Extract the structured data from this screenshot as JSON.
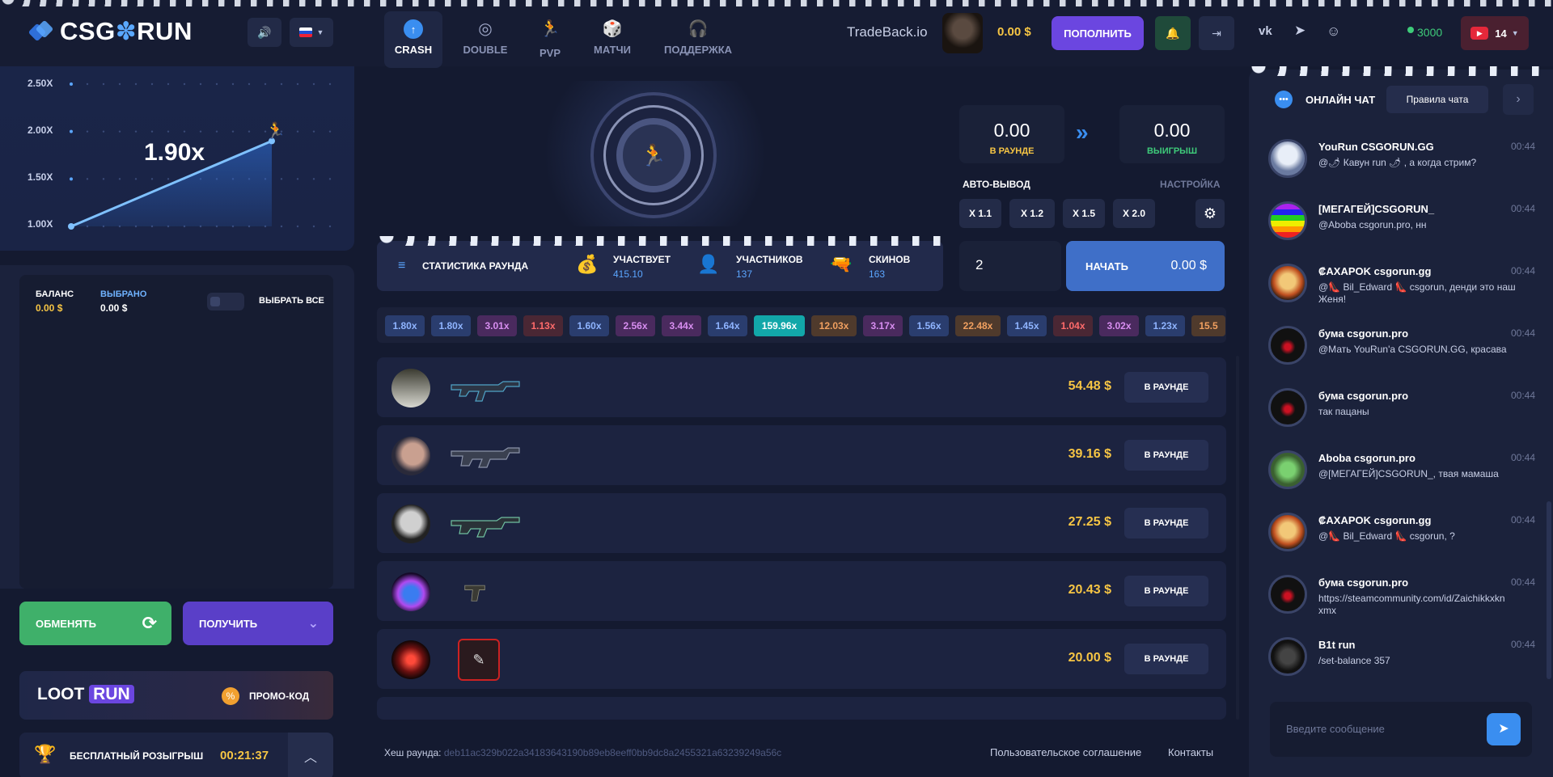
{
  "header": {
    "logo_text_a": "CSG",
    "logo_text_b": "RUN",
    "nav": [
      {
        "label": "CRASH",
        "icon": "crash-icon"
      },
      {
        "label": "DOUBLE",
        "icon": "double-icon"
      },
      {
        "label": "PVP",
        "icon": "pvp-icon"
      },
      {
        "label": "МАТЧИ",
        "icon": "dice-icon"
      },
      {
        "label": "ПОДДЕРЖКА",
        "icon": "headset-icon"
      }
    ],
    "tradeback": "TradeBack.io",
    "user_balance": "0.00 $",
    "deposit_label": "ПОПОЛНИТЬ",
    "online_count": "3000",
    "youtube_count": "14"
  },
  "chart": {
    "multiplier": "1.90x",
    "ylabels": [
      "2.50X",
      "2.00X",
      "1.50X",
      "1.00X"
    ]
  },
  "chart_data": {
    "type": "line",
    "title": "",
    "ylabel": "",
    "ylim": [
      1.0,
      2.5
    ],
    "yticks": [
      "1.00X",
      "1.50X",
      "2.00X",
      "2.50X"
    ],
    "series": [
      {
        "name": "",
        "values": [
          1.0,
          1.9
        ]
      }
    ]
  },
  "balance": {
    "balance_label": "БАЛАНС",
    "balance_value": "0.00 $",
    "selected_label": "ВЫБРАНО",
    "selected_value": "0.00 $",
    "select_all": "ВЫБРАТЬ ВСЕ",
    "exchange_label": "ОБМЕНЯТЬ",
    "withdraw_label": "ПОЛУЧИТЬ",
    "loot_a": "LOOT",
    "loot_b": "RUN",
    "promo_label": "ПРОМО-КОД",
    "giveaway_label": "БЕСПЛАТНЫЙ РОЗЫГРЫШ",
    "giveaway_timer": "00:21:37"
  },
  "game": {
    "in_round_value": "0.00",
    "in_round_label": "В РАУНДЕ",
    "win_value": "0.00",
    "win_label": "ВЫИГРЫШ",
    "auto_label": "АВТО-ВЫВОД",
    "settings_label": "НАСТРОЙКА",
    "chips": [
      "X 1.1",
      "X 1.2",
      "X 1.5",
      "X 2.0"
    ],
    "bet_value": "2",
    "start_label": "НАЧАТЬ",
    "start_amount": "0.00 $"
  },
  "stats": {
    "title": "СТАТИСТИКА РАУНДА",
    "participates_label": "УЧАСТВУЕТ",
    "participates_value": "415.10",
    "players_label": "УЧАСТНИКОВ",
    "players_value": "137",
    "skins_label": "СКИНОВ",
    "skins_value": "163"
  },
  "history": [
    {
      "v": "1.80x",
      "bg": "#2a3d6e",
      "fg": "#8fb4ff"
    },
    {
      "v": "1.80x",
      "bg": "#2a3d6e",
      "fg": "#8fb4ff"
    },
    {
      "v": "3.01x",
      "bg": "#4a2a5e",
      "fg": "#d88ef0"
    },
    {
      "v": "1.13x",
      "bg": "#4a2734",
      "fg": "#ff6b6b"
    },
    {
      "v": "1.60x",
      "bg": "#2a3d6e",
      "fg": "#8fb4ff"
    },
    {
      "v": "2.56x",
      "bg": "#4a2a5e",
      "fg": "#d88ef0"
    },
    {
      "v": "3.44x",
      "bg": "#4a2a5e",
      "fg": "#d88ef0"
    },
    {
      "v": "1.64x",
      "bg": "#2a3d6e",
      "fg": "#8fb4ff"
    },
    {
      "v": "159.96x",
      "bg": "#12a7a9",
      "fg": "#ffffff"
    },
    {
      "v": "12.03x",
      "bg": "#4f3a2c",
      "fg": "#f1a060"
    },
    {
      "v": "3.17x",
      "bg": "#4a2a5e",
      "fg": "#d88ef0"
    },
    {
      "v": "1.56x",
      "bg": "#2a3d6e",
      "fg": "#8fb4ff"
    },
    {
      "v": "22.48x",
      "bg": "#4f3a2c",
      "fg": "#f1a060"
    },
    {
      "v": "1.45x",
      "bg": "#2a3d6e",
      "fg": "#8fb4ff"
    },
    {
      "v": "1.04x",
      "bg": "#4a2734",
      "fg": "#ff6b6b"
    },
    {
      "v": "3.02x",
      "bg": "#4a2a5e",
      "fg": "#d88ef0"
    },
    {
      "v": "1.23x",
      "bg": "#2a3d6e",
      "fg": "#8fb4ff"
    },
    {
      "v": "15.5",
      "bg": "#4f3a2c",
      "fg": "#f1a060"
    }
  ],
  "bets": [
    {
      "amount": "54.48 $",
      "status": "В РАУНДЕ"
    },
    {
      "amount": "39.16 $",
      "status": "В РАУНДЕ"
    },
    {
      "amount": "27.25 $",
      "status": "В РАУНДЕ"
    },
    {
      "amount": "20.43 $",
      "status": "В РАУНДЕ"
    },
    {
      "amount": "20.00 $",
      "status": "В РАУНДЕ"
    }
  ],
  "footer": {
    "hash_label": "Хеш раунда:",
    "hash_value": "deb11ac329b022a34183643190b89eb8eeff0bb9dc8a2455321a63239249a56c",
    "terms": "Пользовательское соглашение",
    "contacts": "Контакты"
  },
  "chat": {
    "title": "ОНЛАЙН ЧАТ",
    "rules": "Правила чата",
    "input_placeholder": "Введите сообщение",
    "messages": [
      {
        "name": "YouRun CSGORUN.GG",
        "time": "00:44",
        "text": "@🌶 Кавун run 🌶 , а когда стрим?"
      },
      {
        "name": "[МЕГАГЕЙ]CSGORUN_",
        "time": "00:44",
        "text": "@Aboba csgorun.pro, нн"
      },
      {
        "name": "₡AXAPOK csgorun.gg",
        "time": "00:44",
        "text": "@👠 Bil_Edward 👠 csgorun, денди это наш Женя!"
      },
      {
        "name": "бума csgorun.pro",
        "time": "00:44",
        "text": "@Мать YouRun'a CSGORUN.GG, красава"
      },
      {
        "name": "бума csgorun.pro",
        "time": "00:44",
        "text": "так пацаны"
      },
      {
        "name": "Aboba csgorun.pro",
        "time": "00:44",
        "text": "@[МЕГАГЕЙ]CSGORUN_, твая мамаша"
      },
      {
        "name": "₡AXAPOK csgorun.gg",
        "time": "00:44",
        "text": "@👠 Bil_Edward 👠 csgorun, ?"
      },
      {
        "name": "бума csgorun.pro",
        "time": "00:44",
        "text": "https://steamcommunity.com/id/Zaichikkxkn xmx"
      },
      {
        "name": "B1t run",
        "time": "00:44",
        "text": "/set-balance 357"
      }
    ]
  }
}
